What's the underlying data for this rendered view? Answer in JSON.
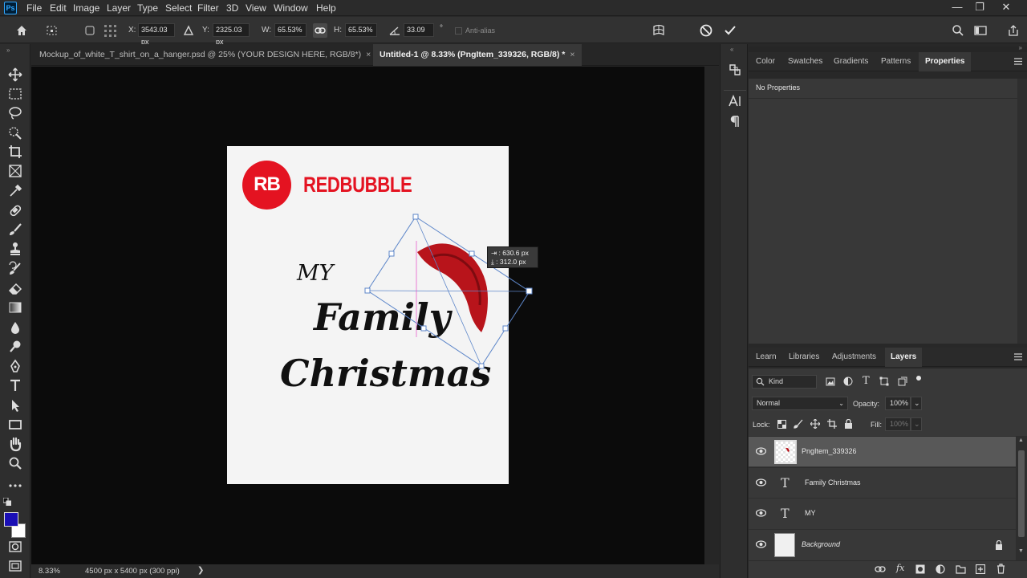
{
  "app": {
    "logo_text": "Ps",
    "accent": "#31a8ff"
  },
  "menu": [
    "File",
    "Edit",
    "Image",
    "Layer",
    "Type",
    "Select",
    "Filter",
    "3D",
    "View",
    "Window",
    "Help"
  ],
  "window_controls": [
    "minimize-icon",
    "restore-icon",
    "close-icon"
  ],
  "options_bar": {
    "x_label": "X:",
    "x_value": "3543.03 px",
    "y_label": "Y:",
    "y_value": "2325.03 px",
    "w_label": "W:",
    "w_value": "65.53%",
    "h_label": "H:",
    "h_value": "65.53%",
    "angle_value": "33.09",
    "angle_unit": "°",
    "antialias_label": "Anti-alias"
  },
  "doc_tabs": [
    {
      "label": "Mockup_of_white_T_shirt_on_a_hanger.psd @ 25% (YOUR DESIGN HERE, RGB/8*)",
      "close": "×",
      "active": false
    },
    {
      "label": "Untitled-1 @ 8.33% (PngItem_339326, RGB/8) *",
      "close": "×",
      "active": true
    }
  ],
  "canvas": {
    "brand": "REDBUBBLE",
    "brand_mark": "RB",
    "brand_color": "#e41321",
    "line1": "MY",
    "line2": "Family",
    "line3": "Christmas",
    "tooltip_w": "630.6 px",
    "tooltip_h": "312.0 px"
  },
  "status": {
    "zoom": "8.33%",
    "doc_size": "4500 px x 5400 px (300 ppi)",
    "arrow": "❯"
  },
  "panels_top": {
    "tabs": [
      "Color",
      "Swatches",
      "Gradients",
      "Patterns",
      "Properties"
    ],
    "active": "Properties",
    "body_text": "No Properties"
  },
  "panels_bottom": {
    "tabs": [
      "Learn",
      "Libraries",
      "Adjustments",
      "Layers"
    ],
    "active": "Layers",
    "kind_label": "Kind",
    "blend_mode": "Normal",
    "opacity_label": "Opacity:",
    "opacity_value": "100%",
    "lock_label": "Lock:",
    "fill_label": "Fill:",
    "fill_value": "100%"
  },
  "layers": [
    {
      "name": "PngItem_339326",
      "kind": "image",
      "selected": true
    },
    {
      "name": "Family Christmas",
      "kind": "text",
      "selected": false
    },
    {
      "name": "MY",
      "kind": "text",
      "selected": false
    },
    {
      "name": "Background",
      "kind": "background",
      "selected": false,
      "locked": true
    }
  ],
  "colors": {
    "foreground": "#1a0fb5",
    "background": "#ffffff"
  }
}
